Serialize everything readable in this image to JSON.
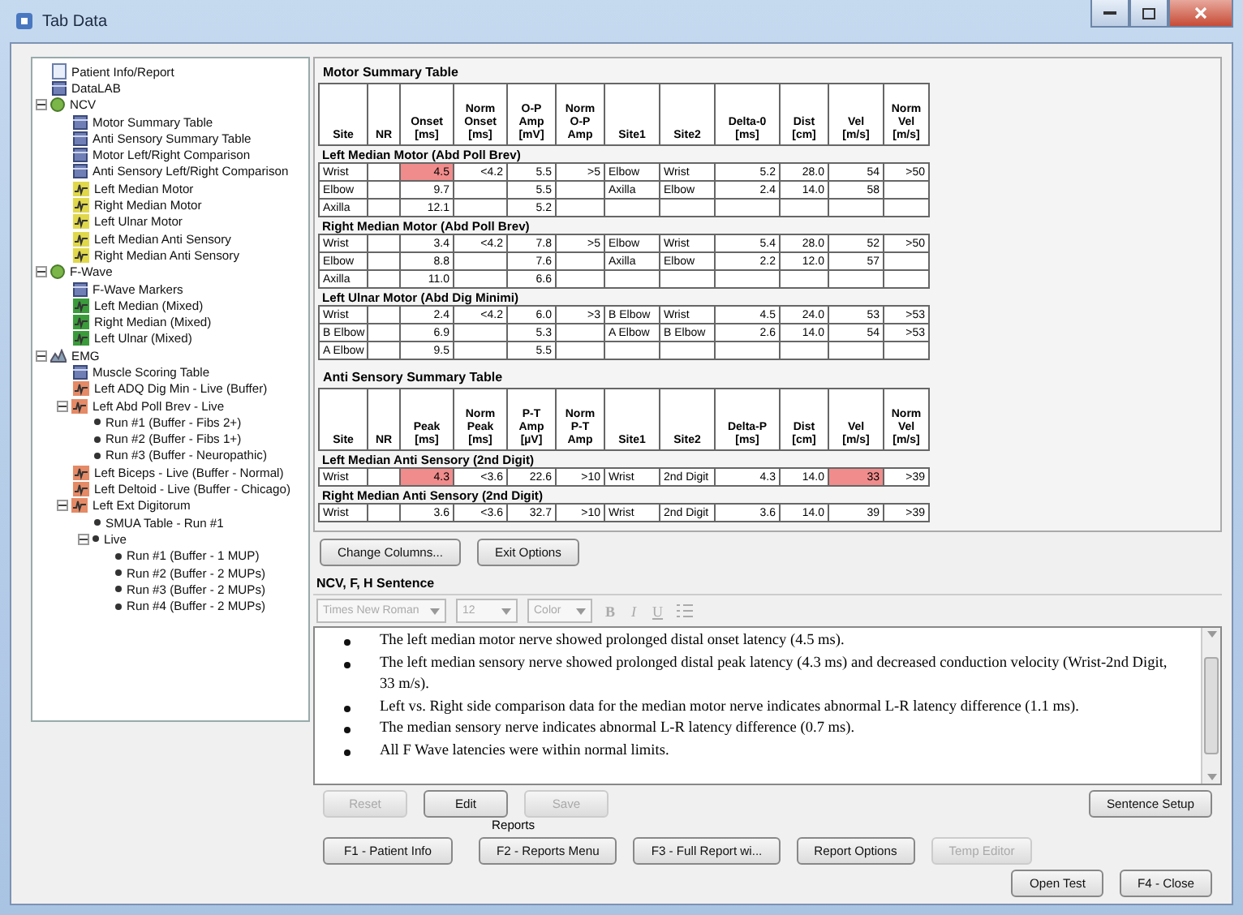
{
  "window": {
    "title": "Tab Data"
  },
  "tree": [
    {
      "label": "Patient Info/Report",
      "kind": "doc"
    },
    {
      "label": "DataLAB",
      "kind": "table"
    },
    {
      "label": "NCV",
      "kind": "ncv",
      "expanded": true,
      "children": [
        {
          "label": "Motor Summary Table",
          "kind": "table"
        },
        {
          "label": "Anti Sensory Summary Table",
          "kind": "table"
        },
        {
          "label": "Motor Left/Right Comparison",
          "kind": "table"
        },
        {
          "label": "Anti Sensory Left/Right Comparison",
          "kind": "table"
        },
        {
          "label": "Left Median Motor",
          "kind": "nerve"
        },
        {
          "label": "Right Median Motor",
          "kind": "nerve"
        },
        {
          "label": "Left Ulnar Motor",
          "kind": "nerve"
        },
        {
          "label": "Left Median Anti Sensory",
          "kind": "nerve"
        },
        {
          "label": "Right Median Anti Sensory",
          "kind": "nerve"
        }
      ]
    },
    {
      "label": "F-Wave",
      "kind": "fwave",
      "expanded": true,
      "children": [
        {
          "label": "F-Wave Markers",
          "kind": "table"
        },
        {
          "label": "Left Median (Mixed)",
          "kind": "wave"
        },
        {
          "label": "Right Median (Mixed)",
          "kind": "wave"
        },
        {
          "label": "Left Ulnar (Mixed)",
          "kind": "wave"
        }
      ]
    },
    {
      "label": "EMG",
      "kind": "emg",
      "expanded": true,
      "children": [
        {
          "label": "Muscle Scoring Table",
          "kind": "table"
        },
        {
          "label": "Left ADQ Dig Min - Live (Buffer)",
          "kind": "muscle"
        },
        {
          "label": "Left Abd Poll Brev - Live",
          "kind": "muscle",
          "expanded": true,
          "children": [
            {
              "label": "Run #1 (Buffer - Fibs 2+)",
              "kind": "run"
            },
            {
              "label": "Run #2 (Buffer - Fibs 1+)",
              "kind": "run"
            },
            {
              "label": "Run #3 (Buffer - Neuropathic)",
              "kind": "run"
            }
          ]
        },
        {
          "label": "Left Biceps - Live (Buffer - Normal)",
          "kind": "muscle"
        },
        {
          "label": "Left Deltoid - Live (Buffer - Chicago)",
          "kind": "muscle"
        },
        {
          "label": "Left Ext Digitorum",
          "kind": "muscle",
          "expanded": true,
          "children": [
            {
              "label": "SMUA Table - Run #1",
              "kind": "run"
            },
            {
              "label": "Live",
              "kind": "run",
              "expanded": true,
              "children": [
                {
                  "label": "Run #1 (Buffer - 1 MUP)",
                  "kind": "run"
                },
                {
                  "label": "Run #2 (Buffer - 2 MUPs)",
                  "kind": "run"
                },
                {
                  "label": "Run #3 (Buffer - 2 MUPs)",
                  "kind": "run"
                },
                {
                  "label": "Run #4 (Buffer - 2 MUPs)",
                  "kind": "run"
                }
              ]
            }
          ]
        }
      ]
    }
  ],
  "motor_table": {
    "title": "Motor Summary Table",
    "columns": [
      [
        "Site"
      ],
      [
        "NR"
      ],
      [
        "Onset",
        "[ms]"
      ],
      [
        "Norm",
        "Onset",
        "[ms]"
      ],
      [
        "O-P",
        "Amp",
        "[mV]"
      ],
      [
        "Norm",
        "O-P",
        "Amp"
      ],
      [
        "Site1"
      ],
      [
        "Site2"
      ],
      [
        "Delta-0",
        "[ms]"
      ],
      [
        "Dist",
        "[cm]"
      ],
      [
        "Vel",
        "[m/s]"
      ],
      [
        "Norm",
        "Vel",
        "[m/s]"
      ]
    ],
    "groups": [
      {
        "title": "Left Median Motor (Abd Poll Brev)",
        "rows": [
          {
            "cells": [
              "Wrist",
              null,
              {
                "text": "4.5",
                "abnormal": true
              },
              "<4.2",
              "5.5",
              ">5",
              "Elbow",
              "Wrist",
              "5.2",
              "28.0",
              "54",
              ">50"
            ]
          },
          {
            "cells": [
              "Elbow",
              null,
              "9.7",
              null,
              "5.5",
              null,
              "Axilla",
              "Elbow",
              "2.4",
              "14.0",
              "58",
              null
            ]
          },
          {
            "cells": [
              "Axilla",
              null,
              "12.1",
              null,
              "5.2",
              null,
              null,
              null,
              null,
              null,
              null,
              null
            ]
          }
        ]
      },
      {
        "title": "Right Median Motor (Abd Poll Brev)",
        "rows": [
          {
            "cells": [
              "Wrist",
              null,
              "3.4",
              "<4.2",
              "7.8",
              ">5",
              "Elbow",
              "Wrist",
              "5.4",
              "28.0",
              "52",
              ">50"
            ]
          },
          {
            "cells": [
              "Elbow",
              null,
              "8.8",
              null,
              "7.6",
              null,
              "Axilla",
              "Elbow",
              "2.2",
              "12.0",
              "57",
              null
            ]
          },
          {
            "cells": [
              "Axilla",
              null,
              "11.0",
              null,
              "6.6",
              null,
              null,
              null,
              null,
              null,
              null,
              null
            ]
          }
        ]
      },
      {
        "title": "Left Ulnar Motor (Abd Dig Minimi)",
        "rows": [
          {
            "cells": [
              "Wrist",
              null,
              "2.4",
              "<4.2",
              "6.0",
              ">3",
              "B Elbow",
              "Wrist",
              "4.5",
              "24.0",
              "53",
              ">53"
            ]
          },
          {
            "cells": [
              "B Elbow",
              null,
              "6.9",
              null,
              "5.3",
              null,
              "A Elbow",
              "B Elbow",
              "2.6",
              "14.0",
              "54",
              ">53"
            ]
          },
          {
            "cells": [
              "A Elbow",
              null,
              "9.5",
              null,
              "5.5",
              null,
              null,
              null,
              null,
              null,
              null,
              null
            ]
          }
        ]
      }
    ]
  },
  "sensory_table": {
    "title": "Anti Sensory Summary Table",
    "columns": [
      [
        "Site"
      ],
      [
        "NR"
      ],
      [
        "Peak",
        "[ms]"
      ],
      [
        "Norm",
        "Peak",
        "[ms]"
      ],
      [
        "P-T",
        "Amp",
        "[µV]"
      ],
      [
        "Norm",
        "P-T",
        "Amp"
      ],
      [
        "Site1"
      ],
      [
        "Site2"
      ],
      [
        "Delta-P",
        "[ms]"
      ],
      [
        "Dist",
        "[cm]"
      ],
      [
        "Vel",
        "[m/s]"
      ],
      [
        "Norm",
        "Vel",
        "[m/s]"
      ]
    ],
    "groups": [
      {
        "title": "Left Median Anti Sensory (2nd Digit)",
        "rows": [
          {
            "cells": [
              "Wrist",
              null,
              {
                "text": "4.3",
                "abnormal": true
              },
              "<3.6",
              "22.6",
              ">10",
              "Wrist",
              "2nd Digit",
              "4.3",
              "14.0",
              {
                "text": "33",
                "abnormal": true
              },
              ">39"
            ]
          }
        ]
      },
      {
        "title": "Right Median Anti Sensory (2nd Digit)",
        "rows": [
          {
            "cells": [
              "Wrist",
              null,
              "3.6",
              "<3.6",
              "32.7",
              ">10",
              "Wrist",
              "2nd Digit",
              "3.6",
              "14.0",
              "39",
              ">39"
            ]
          }
        ]
      }
    ]
  },
  "table_buttons": [
    "Change Columns...",
    "Exit Options"
  ],
  "sentence": {
    "title": "NCV, F, H Sentence",
    "font": "Times New Roman",
    "size": "12",
    "color_picker": "Color",
    "format_buttons": [
      "B",
      "I",
      "U"
    ],
    "bullets": [
      "The left median motor nerve showed prolonged distal onset latency (4.5 ms).",
      "The left median sensory nerve showed prolonged distal peak latency (4.3 ms) and decreased conduction velocity (Wrist-2nd Digit, 33 m/s).",
      "Left vs. Right side comparison data for the median motor nerve indicates abnormal L-R latency difference (1.1 ms).",
      "The median sensory nerve indicates abnormal L-R latency difference (0.7 ms).",
      "All F Wave latencies were within normal limits."
    ]
  },
  "edit_buttons": [
    {
      "label": "Reset",
      "disabled": true
    },
    {
      "label": "Edit",
      "disabled": false
    },
    {
      "label": "Save",
      "disabled": true
    }
  ],
  "sentence_setup": "Sentence Setup",
  "reports_label": "Reports",
  "report_buttons": [
    {
      "label": "F1 - Patient Info",
      "disabled": false
    },
    {
      "label": "F2 - Reports Menu",
      "disabled": false
    },
    {
      "label": "F3 - Full Report wi...",
      "disabled": false
    },
    {
      "label": "Report Options",
      "disabled": false
    },
    {
      "label": "Temp Editor",
      "disabled": true
    }
  ],
  "close_buttons": [
    "Open Test",
    "F4 - Close"
  ]
}
